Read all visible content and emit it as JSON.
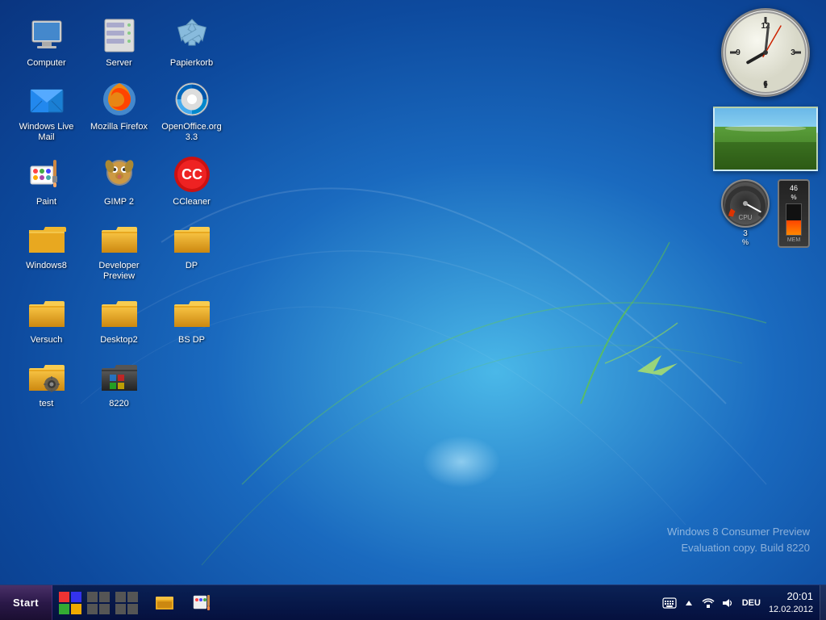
{
  "desktop": {
    "background": "windows7-blue",
    "watermark_line1": "Windows 8 Consumer Preview",
    "watermark_line2": "Evaluation copy. Build 8220"
  },
  "icons": [
    {
      "id": "computer",
      "label": "Computer",
      "type": "computer",
      "row": 0,
      "col": 0
    },
    {
      "id": "server",
      "label": "Server",
      "type": "server",
      "row": 0,
      "col": 1
    },
    {
      "id": "papierkorb",
      "label": "Papierkorb",
      "type": "recycle",
      "row": 0,
      "col": 2
    },
    {
      "id": "windows-live-mail",
      "label": "Windows Live Mail",
      "type": "mail",
      "row": 1,
      "col": 0
    },
    {
      "id": "mozilla-firefox",
      "label": "Mozilla Firefox",
      "type": "firefox",
      "row": 1,
      "col": 1
    },
    {
      "id": "openoffice",
      "label": "OpenOffice.org 3.3",
      "type": "openoffice",
      "row": 1,
      "col": 2
    },
    {
      "id": "paint",
      "label": "Paint",
      "type": "paint",
      "row": 2,
      "col": 0
    },
    {
      "id": "gimp",
      "label": "GIMP 2",
      "type": "gimp",
      "row": 2,
      "col": 1
    },
    {
      "id": "ccleaner",
      "label": "CCleaner",
      "type": "ccleaner",
      "row": 2,
      "col": 2
    },
    {
      "id": "windows8",
      "label": "Windows8",
      "type": "folder",
      "row": 3,
      "col": 0
    },
    {
      "id": "developer-preview",
      "label": "Developer Preview",
      "type": "folder",
      "row": 3,
      "col": 1
    },
    {
      "id": "dp",
      "label": "DP",
      "type": "folder",
      "row": 3,
      "col": 2
    },
    {
      "id": "versuch",
      "label": "Versuch",
      "type": "folder",
      "row": 4,
      "col": 0
    },
    {
      "id": "desktop2",
      "label": "Desktop2",
      "type": "folder",
      "row": 4,
      "col": 1
    },
    {
      "id": "bs-dp",
      "label": "BS DP",
      "type": "folder",
      "row": 4,
      "col": 2
    },
    {
      "id": "test",
      "label": "test",
      "type": "folder-special",
      "row": 5,
      "col": 0
    },
    {
      "id": "8220",
      "label": "8220",
      "type": "folder-special2",
      "row": 5,
      "col": 1
    }
  ],
  "clock": {
    "hour": 20,
    "minute": 1,
    "display_time": "20:01",
    "display_date": "12.02.2012"
  },
  "taskbar": {
    "start_label": "Start",
    "apps": [
      {
        "id": "explorer",
        "label": "Windows Explorer"
      },
      {
        "id": "paint-taskbar",
        "label": "Paint"
      }
    ],
    "tray": {
      "language": "DEU",
      "time": "20:01",
      "date": "12.02.2012"
    }
  },
  "gauge": {
    "cpu_percent": 3,
    "mem_percent": 46
  }
}
